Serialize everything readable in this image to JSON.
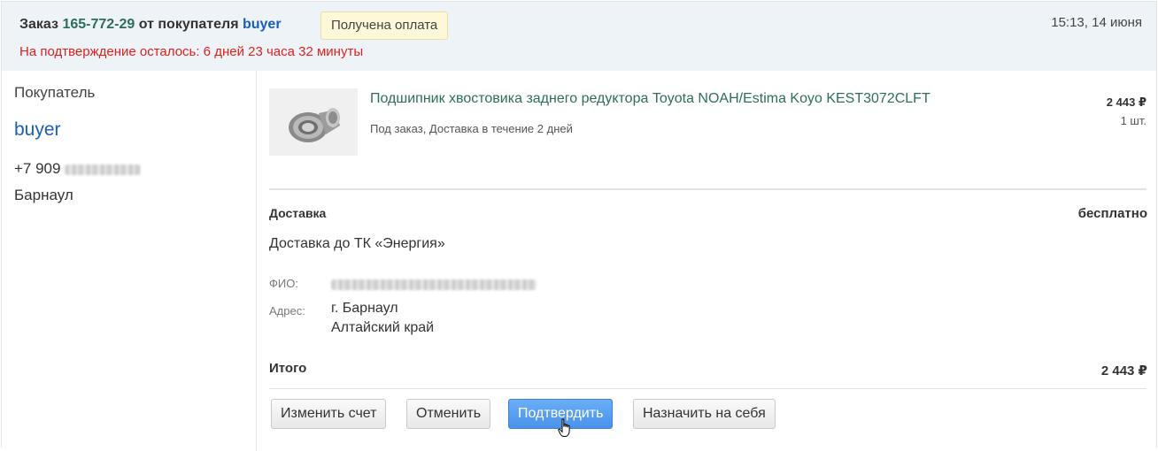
{
  "order": {
    "label_prefix": "Заказ",
    "number": "165-772-29",
    "from_text": "от покупателя",
    "buyer": "buyer",
    "status": "Получена оплата",
    "deadline": "На подтверждение осталось: 6 дней 23 часа 32 минуты",
    "time": "15:13, 14 июня"
  },
  "customer": {
    "label": "Покупатель",
    "name": "buyer",
    "phone_prefix": "+7 909",
    "city": "Барнаул"
  },
  "product": {
    "image_icon": "bearing-icon",
    "name": "Подшипник хвостовика заднего редуктора Toyota NOAH/Estima Koyo KEST3072CLFT",
    "availability": "Под заказ, Доставка в течение 2 дней",
    "price": "2 443 ₽",
    "quantity": "1 шт."
  },
  "delivery": {
    "title": "Доставка",
    "cost": "бесплатно",
    "method": "Доставка до ТК «Энергия»",
    "fio_label": "ФИО:",
    "address_label": "Адрес:",
    "address_line1": "г. Барнаул",
    "address_line2": "Алтайский край"
  },
  "total": {
    "label": "Итого",
    "value": "2 443 ₽"
  },
  "actions": {
    "change_invoice": "Изменить счет",
    "cancel": "Отменить",
    "confirm": "Подтвердить",
    "assign_self": "Назначить на себя"
  },
  "colors": {
    "header_bg": "#eef3f7",
    "order_number": "#2d6d5e",
    "link": "#1a5fb4",
    "deadline": "#e0201d",
    "status_badge_bg": "#fdf8d8",
    "primary_button": "#4a92ea"
  }
}
